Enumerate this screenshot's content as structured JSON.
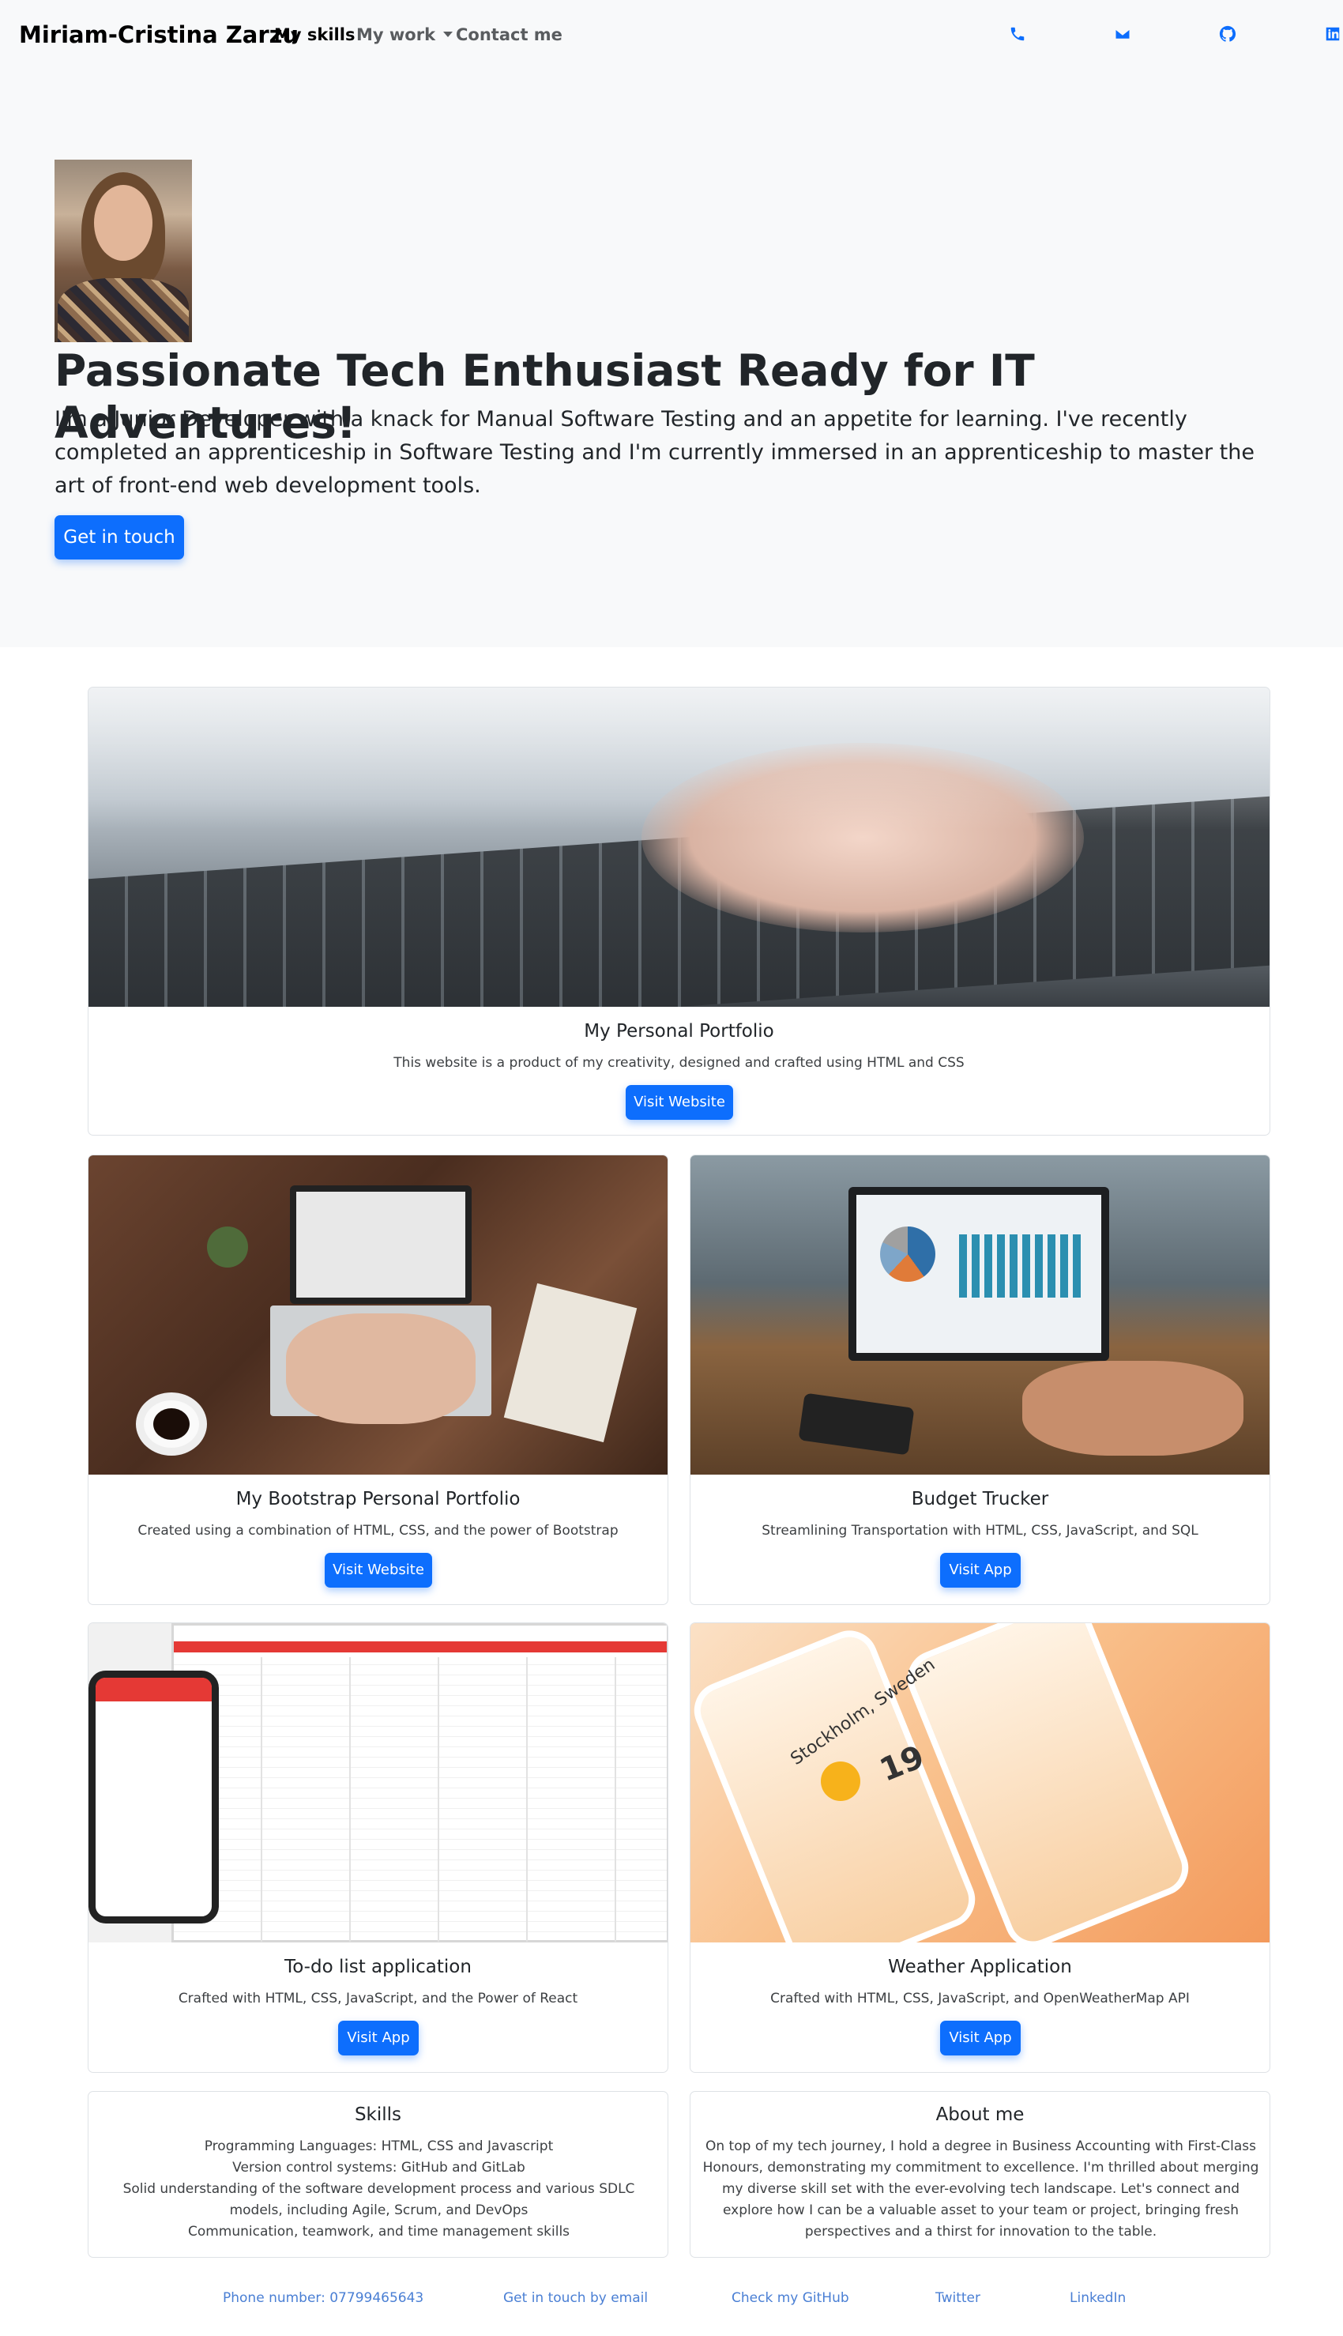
{
  "nav": {
    "brand": "Miriam-Cristina Zarzu",
    "links": [
      {
        "label": "My skills"
      },
      {
        "label": "My work"
      },
      {
        "label": "Contact me"
      }
    ],
    "icons": [
      "phone-icon",
      "envelope-icon",
      "github-icon",
      "linkedin-icon"
    ],
    "accent_color": "#0d6efd"
  },
  "hero": {
    "title": "Passionate Tech Enthusiast Ready for IT Adventures!",
    "text": "I'm a Junior Developer with a knack for Manual Software Testing and an appetite for learning. I've recently completed an apprenticeship in Software Testing and I'm currently immersed in an apprenticeship to master the art of front-end web development tools.",
    "button": "Get in touch"
  },
  "projects": [
    {
      "title": "My Personal Portfolio",
      "text": "This website is a product of my creativity, designed and crafted using HTML and CSS",
      "button": "Visit Website"
    },
    {
      "title": "My Bootstrap Personal Portfolio",
      "text": "Created using a combination of HTML, CSS, and the power of Bootstrap",
      "button": "Visit Website"
    },
    {
      "title": "Budget Trucker",
      "text": "Streamlining Transportation with HTML, CSS, JavaScript, and SQL",
      "button": "Visit App"
    },
    {
      "title": "To-do list application",
      "text": "Crafted with HTML, CSS, JavaScript, and the Power of React",
      "button": "Visit App"
    },
    {
      "title": "Weather Application",
      "text": "Crafted with HTML, CSS, JavaScript, and OpenWeatherMap API",
      "button": "Visit App"
    }
  ],
  "weather_preview": {
    "city": "Stockholm, Sweden",
    "temp": "19"
  },
  "skills": {
    "title": "Skills",
    "items": [
      "Programming Languages: HTML, CSS and Javascript",
      "Version control systems: GitHub and GitLab",
      "Solid understanding of the software development process and various SDLC models, including Agile, Scrum, and DevOps",
      "Communication, teamwork, and time management skills"
    ]
  },
  "about": {
    "title": "About me",
    "text": "On top of my tech journey, I hold a degree in Business Accounting with First-Class Honours, demonstrating my commitment to excellence. I'm thrilled about merging my diverse skill set with the ever-evolving tech landscape. Let's connect and explore how I can be a valuable asset to your team or project, bringing fresh perspectives and a thirst for innovation to the table."
  },
  "footer": {
    "links": [
      "Phone number: 07799465643",
      "Get in touch by email",
      "Check my GitHub",
      "Twitter",
      "LinkedIn"
    ]
  }
}
